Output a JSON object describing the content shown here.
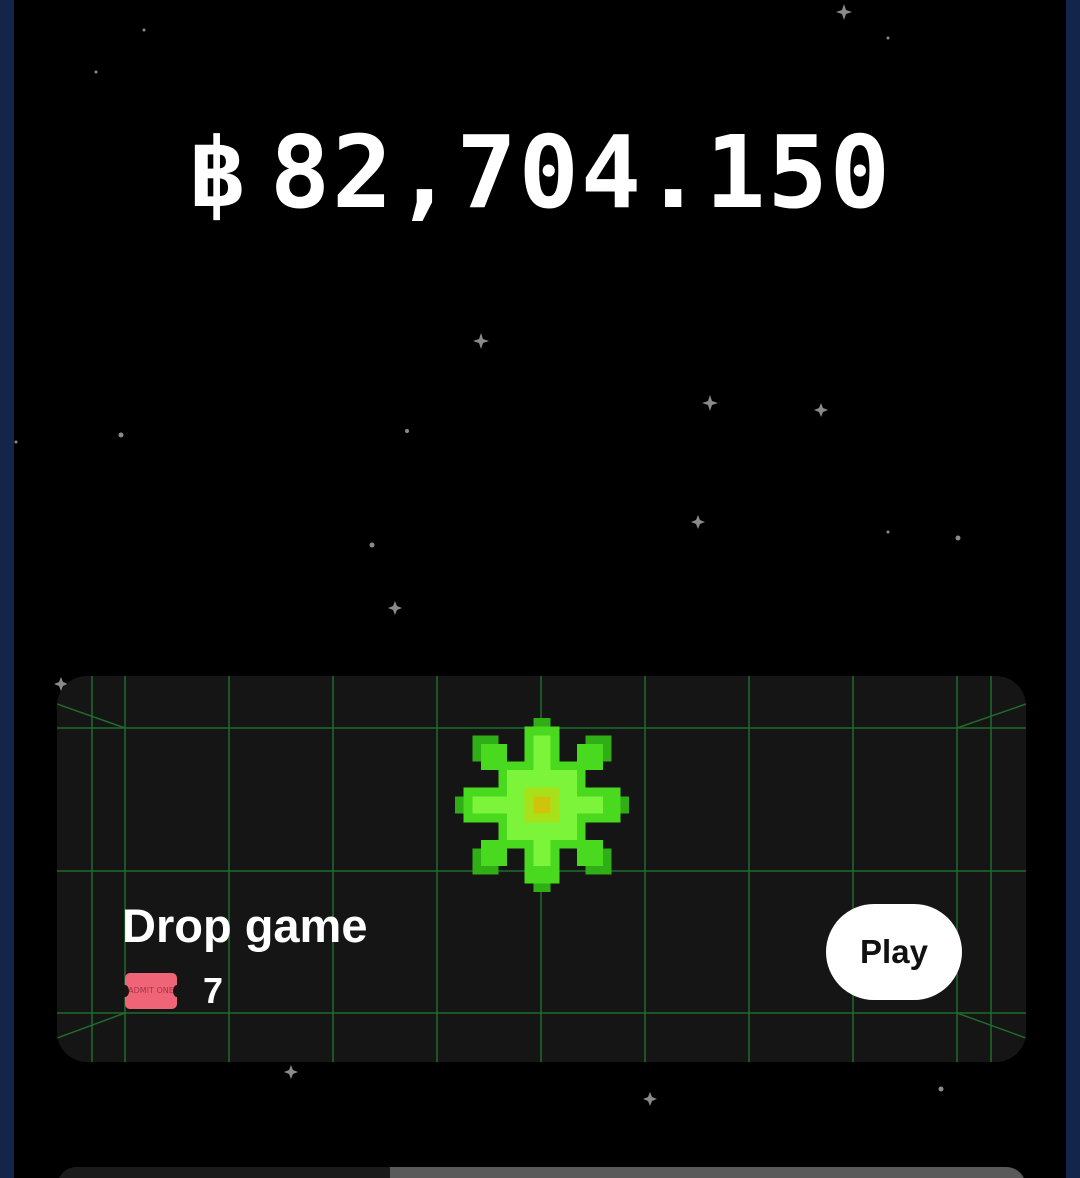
{
  "balance": {
    "currency_symbol": "฿",
    "amount": "82,704.150"
  },
  "game_card": {
    "title": "Drop game",
    "ticket_icon": "admit-one-ticket-icon",
    "ticket_text": "ADMIT ONE",
    "tickets": "7",
    "play_label": "Play",
    "gem_icon": "green-pixel-star-gem-icon"
  },
  "colors": {
    "background": "#000000",
    "frame": "#13254a",
    "card": "#151515",
    "grid_line": "#1f6b2c",
    "gem_green": "#49d91f",
    "ticket": "#f06478"
  }
}
